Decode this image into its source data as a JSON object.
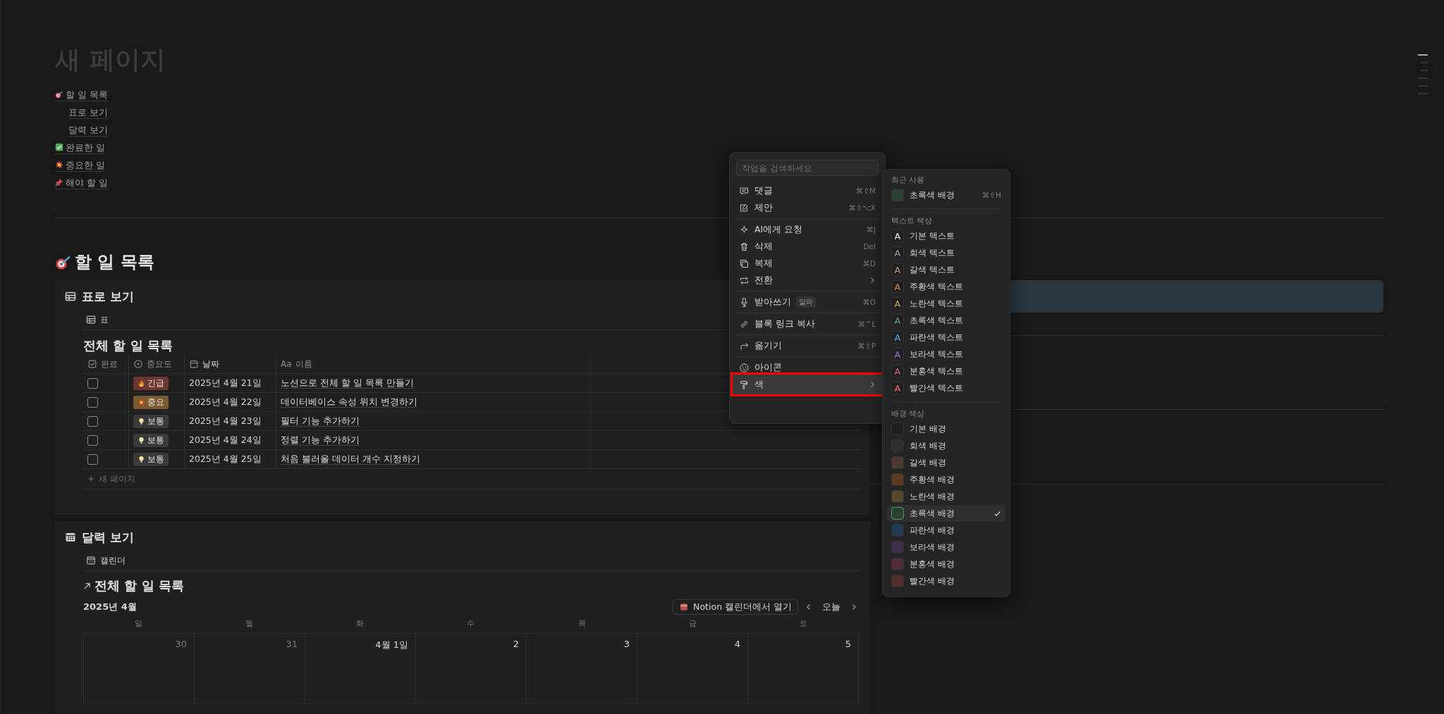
{
  "page": {
    "title": "새 페이지"
  },
  "toc": [
    {
      "label": "할 일 목록",
      "kind": "target",
      "children": [
        {
          "label": "표로 보기"
        },
        {
          "label": "달력 보기"
        }
      ]
    },
    {
      "label": "완료한 일",
      "kind": "check"
    },
    {
      "label": "중요한 일",
      "kind": "burst"
    },
    {
      "label": "해야 할 일",
      "kind": "pin"
    }
  ],
  "section_heading": {
    "label": "할 일 목록",
    "kind": "target"
  },
  "table_view": {
    "title": "표로 보기",
    "selected": true,
    "tab": "표",
    "db_title": "전체 할 일 목록",
    "columns": [
      {
        "label": "완료",
        "kind": "checkbox"
      },
      {
        "label": "중요도",
        "kind": "select"
      },
      {
        "label": "날짜",
        "kind": "date"
      },
      {
        "label": "이름",
        "kind": "title",
        "prefix": "Aa"
      }
    ],
    "rows": [
      {
        "done": false,
        "tag": {
          "label": "긴급",
          "kind": "urgent",
          "color": "#6e3630"
        },
        "date": "2025년 4월 21일",
        "name": "노션으로 전체 할 일 목록 만들기"
      },
      {
        "done": false,
        "tag": {
          "label": "중요",
          "kind": "important",
          "color": "#7a5a2f"
        },
        "date": "2025년 4월 22일",
        "name": "데이터베이스 속성 위치 변경하기"
      },
      {
        "done": false,
        "tag": {
          "label": "보통",
          "kind": "normal",
          "color": "#3a3a3a"
        },
        "date": "2025년 4월 23일",
        "name": "필터 기능 추가하기"
      },
      {
        "done": false,
        "tag": {
          "label": "보통",
          "kind": "normal",
          "color": "#3a3a3a"
        },
        "date": "2025년 4월 24일",
        "name": "정렬 기능 추가하기"
      },
      {
        "done": false,
        "tag": {
          "label": "보통",
          "kind": "normal",
          "color": "#3a3a3a"
        },
        "date": "2025년 4월 25일",
        "name": "처음 불러올 데이터 개수 지정하기"
      }
    ],
    "new_row": "새 페이지"
  },
  "calendar_view": {
    "title": "달력 보기",
    "tab": "캘린더",
    "db_title": "전체 할 일 목록",
    "month": "2025년 4월",
    "open_button": "Notion 캘린더에서 열기",
    "today": "오늘",
    "weekdays": [
      "일",
      "월",
      "화",
      "수",
      "목",
      "금",
      "토"
    ],
    "days": [
      {
        "label": "30",
        "muted": true
      },
      {
        "label": "31",
        "muted": true
      },
      {
        "label": "4월 1일",
        "muted": false
      },
      {
        "label": "2",
        "muted": false
      },
      {
        "label": "3",
        "muted": false
      },
      {
        "label": "4",
        "muted": false
      },
      {
        "label": "5",
        "muted": false
      }
    ]
  },
  "action_menu": {
    "search_placeholder": "작업을 검색하세요",
    "groups": [
      [
        {
          "label": "댓글",
          "kind": "comment",
          "shortcut": "⌘⇧M",
          "selected": false
        },
        {
          "label": "제안",
          "kind": "suggest",
          "shortcut": "⌘⇧⌥X",
          "selected": false
        }
      ],
      [
        {
          "label": "AI에게 요청",
          "kind": "ai",
          "shortcut": "⌘J",
          "selected": false
        },
        {
          "label": "삭제",
          "kind": "delete",
          "shortcut": "Del",
          "selected": false
        },
        {
          "label": "복제",
          "kind": "duplicate",
          "shortcut": "⌘D",
          "selected": false
        },
        {
          "label": "전환",
          "kind": "turn_into",
          "submenu": true,
          "selected": false
        }
      ],
      [
        {
          "label": "받아쓰기",
          "kind": "dictate",
          "badge": "알파",
          "shortcut": "⌘O",
          "selected": false
        }
      ],
      [
        {
          "label": "블록 링크 복사",
          "kind": "link",
          "shortcut": "⌘^L",
          "selected": false
        }
      ],
      [
        {
          "label": "옮기기",
          "kind": "move",
          "shortcut": "⌘⇧P",
          "selected": false
        }
      ],
      [
        {
          "label": "아이콘",
          "kind": "icon",
          "selected": false
        },
        {
          "label": "색",
          "kind": "color",
          "submenu": true,
          "selected": true,
          "outlined": true
        }
      ]
    ]
  },
  "color_menu": {
    "sections": [
      {
        "label": "최근 사용",
        "items": [
          {
            "label": "초록색 배경",
            "kind": "background",
            "color": "#2b3f32",
            "shortcut": "⌘⇧H",
            "selected": false
          }
        ]
      },
      {
        "label": "텍스트 색상",
        "items": [
          {
            "label": "기본 텍스트",
            "kind": "text",
            "glyph": "A",
            "color": "#e6e6e6",
            "selected": false
          },
          {
            "label": "회색 텍스트",
            "kind": "text",
            "glyph": "A",
            "color": "#9b9b9b",
            "selected": false
          },
          {
            "label": "갈색 텍스트",
            "kind": "text",
            "glyph": "A",
            "color": "#ba8e78",
            "selected": false
          },
          {
            "label": "주황색 텍스트",
            "kind": "text",
            "glyph": "A",
            "color": "#cb8a4e",
            "selected": false
          },
          {
            "label": "노란색 텍스트",
            "kind": "text",
            "glyph": "A",
            "color": "#c9a45a",
            "selected": false
          },
          {
            "label": "초록색 텍스트",
            "kind": "text",
            "glyph": "A",
            "color": "#5e9e78",
            "selected": false
          },
          {
            "label": "파란색 텍스트",
            "kind": "text",
            "glyph": "A",
            "color": "#5e9fe0",
            "selected": false
          },
          {
            "label": "보라색 텍스트",
            "kind": "text",
            "glyph": "A",
            "color": "#9a6dd7",
            "selected": false
          },
          {
            "label": "분홍색 텍스트",
            "kind": "text",
            "glyph": "A",
            "color": "#c15f97",
            "selected": false
          },
          {
            "label": "빨간색 텍스트",
            "kind": "text",
            "glyph": "A",
            "color": "#df6b5e",
            "selected": false
          }
        ]
      },
      {
        "label": "배경 색상",
        "items": [
          {
            "label": "기본 배경",
            "kind": "background",
            "color": "#202020",
            "selected": false
          },
          {
            "label": "회색 배경",
            "kind": "background",
            "color": "#2f2f2f",
            "selected": false
          },
          {
            "label": "갈색 배경",
            "kind": "background",
            "color": "#4a3a30",
            "selected": false
          },
          {
            "label": "주황색 배경",
            "kind": "background",
            "color": "#5c3b23",
            "selected": false
          },
          {
            "label": "노란색 배경",
            "kind": "background",
            "color": "#56482a",
            "selected": false
          },
          {
            "label": "초록색 배경",
            "kind": "background",
            "color": "#2b3f32",
            "selected": true
          },
          {
            "label": "파란색 배경",
            "kind": "background",
            "color": "#1f3a55",
            "selected": false
          },
          {
            "label": "보라색 배경",
            "kind": "background",
            "color": "#3c2d4f",
            "selected": false
          },
          {
            "label": "분홍색 배경",
            "kind": "background",
            "color": "#4e2c3c",
            "selected": false
          },
          {
            "label": "빨간색 배경",
            "kind": "background",
            "color": "#522e2a",
            "selected": false
          }
        ]
      }
    ]
  }
}
